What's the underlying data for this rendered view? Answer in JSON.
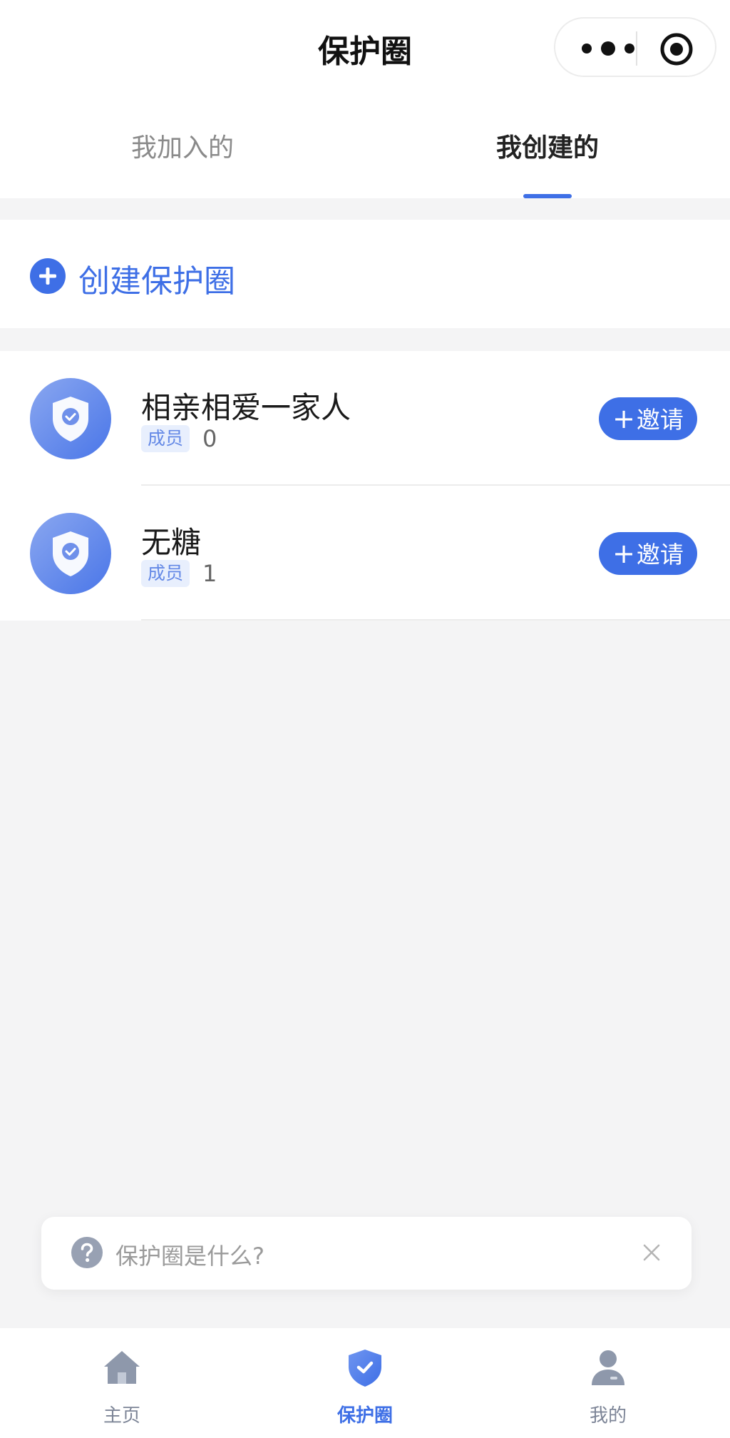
{
  "header": {
    "title": "保护圈"
  },
  "tabs": [
    {
      "label": "我加入的",
      "active": false
    },
    {
      "label": "我创建的",
      "active": true
    }
  ],
  "create": {
    "label": "创建保护圈",
    "icon": "plus-circle-icon"
  },
  "circles": [
    {
      "name": "相亲相爱一家人",
      "member_label": "成员",
      "member_count": "0",
      "invite_label": "邀请"
    },
    {
      "name": "无糖",
      "member_label": "成员",
      "member_count": "1",
      "invite_label": "邀请"
    }
  ],
  "help": {
    "label": "保护圈是什么?",
    "icon": "question-circle-icon"
  },
  "nav": [
    {
      "label": "主页",
      "icon": "home-icon",
      "active": false
    },
    {
      "label": "保护圈",
      "icon": "shield-icon",
      "active": true
    },
    {
      "label": "我的",
      "icon": "user-icon",
      "active": false
    }
  ],
  "colors": {
    "accent": "#3e6fe6",
    "background": "#f4f4f5",
    "tag_bg": "#e8effd",
    "inactive": "#7d8597"
  }
}
